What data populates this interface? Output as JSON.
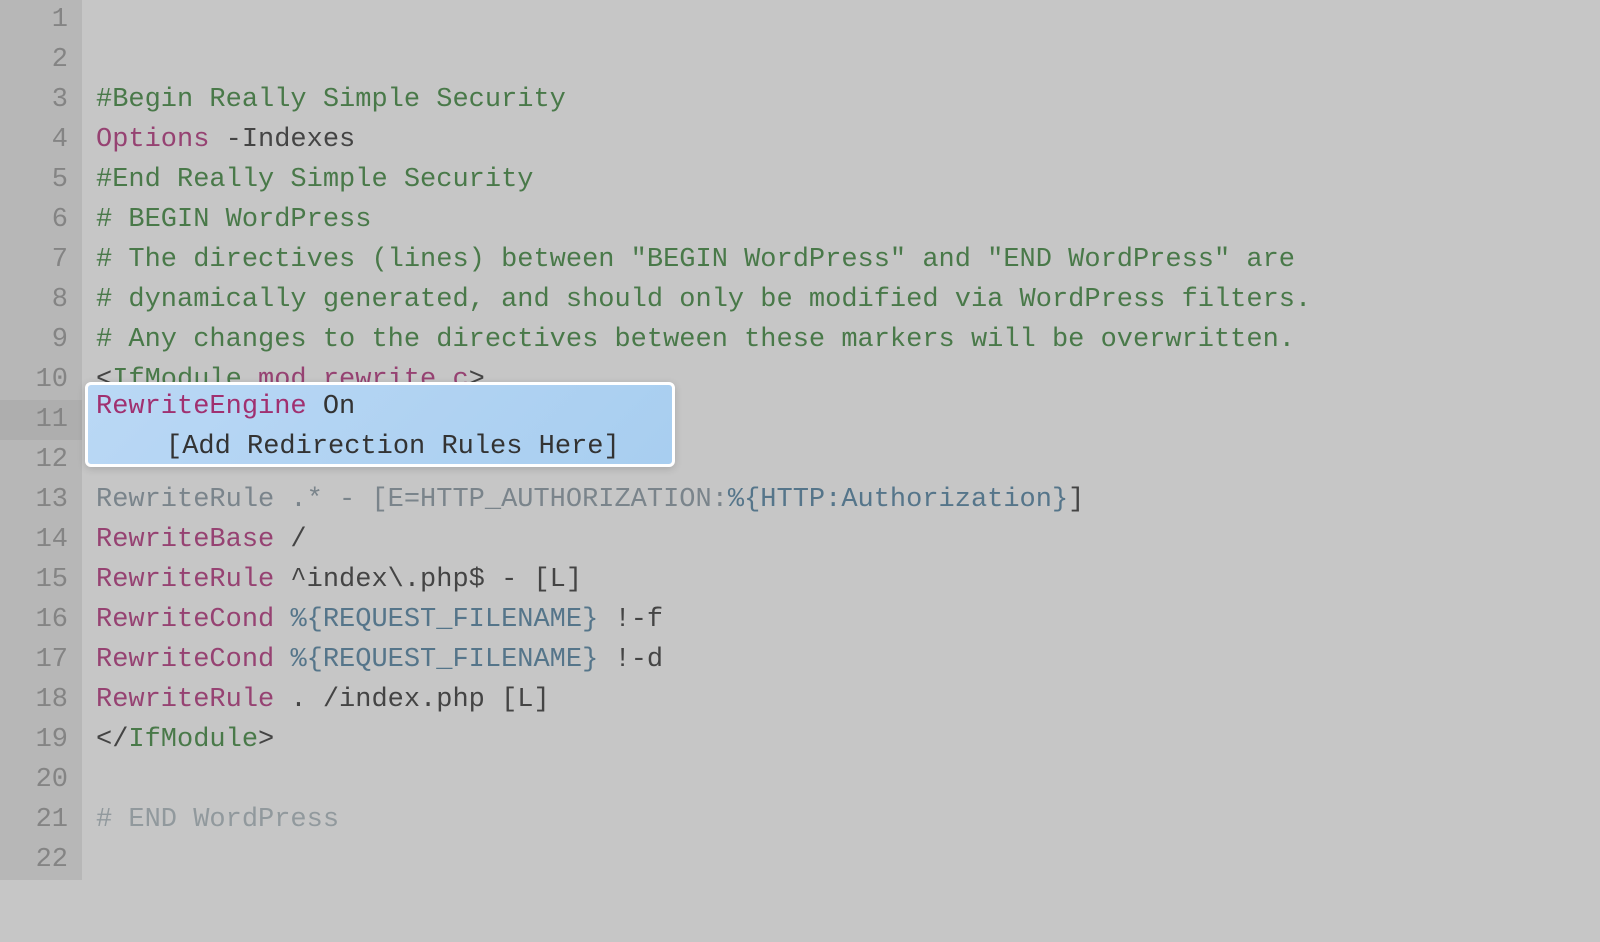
{
  "editor": {
    "lines": [
      {
        "num": "1",
        "tokens": []
      },
      {
        "num": "2",
        "tokens": []
      },
      {
        "num": "3",
        "tokens": [
          {
            "cls": "comment",
            "text": "#Begin Really Simple Security"
          }
        ]
      },
      {
        "num": "4",
        "tokens": [
          {
            "cls": "keyword",
            "text": "Options"
          },
          {
            "cls": "default-text",
            "text": " -Indexes"
          }
        ]
      },
      {
        "num": "5",
        "tokens": [
          {
            "cls": "comment",
            "text": "#End Really Simple Security"
          }
        ]
      },
      {
        "num": "6",
        "tokens": [
          {
            "cls": "comment",
            "text": "# BEGIN WordPress"
          }
        ]
      },
      {
        "num": "7",
        "tokens": [
          {
            "cls": "comment",
            "text": "# The directives (lines) between \"BEGIN WordPress\" and \"END WordPress\" are"
          }
        ]
      },
      {
        "num": "8",
        "tokens": [
          {
            "cls": "comment",
            "text": "# dynamically generated, and should only be modified via WordPress filters."
          }
        ]
      },
      {
        "num": "9",
        "tokens": [
          {
            "cls": "comment",
            "text": "# Any changes to the directives between these markers will be overwritten."
          }
        ]
      },
      {
        "num": "10",
        "tokens": [
          {
            "cls": "tag-bracket",
            "text": "<"
          },
          {
            "cls": "tag-name",
            "text": "IfModule"
          },
          {
            "cls": "default-text",
            "text": " "
          },
          {
            "cls": "attr-value",
            "text": "mod_rewrite.c"
          },
          {
            "cls": "tag-bracket",
            "text": ">"
          }
        ]
      },
      {
        "num": "11",
        "tokens": [
          {
            "cls": "keyword",
            "text": "RewriteEngine"
          },
          {
            "cls": "default-text",
            "text": " On"
          }
        ],
        "current": true
      },
      {
        "num": "12",
        "tokens": []
      },
      {
        "num": "13",
        "tokens": [
          {
            "cls": "line-13-faded",
            "text": "RewriteRule .* - [E=HTTP_AUTHORIZATION:"
          },
          {
            "cls": "variable",
            "text": "%{HTTP:Authorization}"
          },
          {
            "cls": "default-text",
            "text": "]"
          }
        ]
      },
      {
        "num": "14",
        "tokens": [
          {
            "cls": "keyword",
            "text": "RewriteBase"
          },
          {
            "cls": "default-text",
            "text": " /"
          }
        ]
      },
      {
        "num": "15",
        "tokens": [
          {
            "cls": "keyword",
            "text": "RewriteRule"
          },
          {
            "cls": "default-text",
            "text": " ^index\\.php$ - [L]"
          }
        ]
      },
      {
        "num": "16",
        "tokens": [
          {
            "cls": "keyword",
            "text": "RewriteCond"
          },
          {
            "cls": "default-text",
            "text": " "
          },
          {
            "cls": "variable",
            "text": "%{REQUEST_FILENAME}"
          },
          {
            "cls": "default-text",
            "text": " !-f"
          }
        ]
      },
      {
        "num": "17",
        "tokens": [
          {
            "cls": "keyword",
            "text": "RewriteCond"
          },
          {
            "cls": "default-text",
            "text": " "
          },
          {
            "cls": "variable",
            "text": "%{REQUEST_FILENAME}"
          },
          {
            "cls": "default-text",
            "text": " !-d"
          }
        ]
      },
      {
        "num": "18",
        "tokens": [
          {
            "cls": "keyword",
            "text": "RewriteRule"
          },
          {
            "cls": "default-text",
            "text": " . /index.php [L]"
          }
        ]
      },
      {
        "num": "19",
        "tokens": [
          {
            "cls": "tag-bracket",
            "text": "</"
          },
          {
            "cls": "tag-name",
            "text": "IfModule"
          },
          {
            "cls": "tag-bracket",
            "text": ">"
          }
        ]
      },
      {
        "num": "20",
        "tokens": []
      },
      {
        "num": "21",
        "tokens": [
          {
            "cls": "line-21-faded",
            "text": "# END WordPress"
          }
        ]
      },
      {
        "num": "22",
        "tokens": [
          {
            "cls": "line-22-faded",
            "text": ""
          }
        ]
      }
    ]
  },
  "highlight": {
    "line1_keyword": "RewriteEngine",
    "line1_text": " On",
    "line2": "[Add Redirection Rules Here]"
  }
}
